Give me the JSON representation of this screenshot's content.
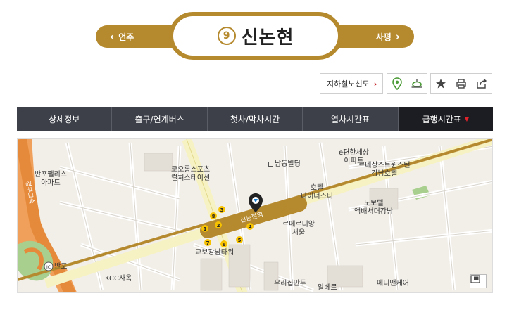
{
  "station": {
    "line_number": "9",
    "name": "신논현",
    "prev_label": "언주",
    "next_label": "사평"
  },
  "tools": {
    "subway_map_link": "지하철노선도",
    "icons": [
      "location-pin-icon",
      "bus-stop-icon",
      "star-icon",
      "print-icon",
      "share-icon"
    ]
  },
  "tabs": [
    {
      "label": "상세정보"
    },
    {
      "label": "출구/연계버스"
    },
    {
      "label": "첫차/막차시간"
    },
    {
      "label": "열차시간표"
    },
    {
      "label": "급행시간표"
    }
  ],
  "map": {
    "labels": {
      "namdong": "남동빌딩",
      "e_pyeonhan": "e편한세상\n아파트",
      "gangnam_west": "르네상스트윈스턴\n강남호텔",
      "banpo_palace": "반포팰리스\n아파트",
      "kolon": "코오롱스포츠\n컬쳐스테이션",
      "hotel_dynasty": "호텔\n다이너스티",
      "nobotel": "노보텔\n앰배서더강남",
      "station": "신논현역",
      "rehmer": "르메르디앙\n서울",
      "kyobo": "교보강남타워",
      "kcc": "KCC사옥",
      "woori": "우리집만두",
      "almere": "알베르",
      "meditcare": "메디앤케어",
      "banpo_ic": "반포",
      "expressway": "경부고속"
    },
    "exits": [
      "1",
      "2",
      "3",
      "4",
      "5",
      "6",
      "7",
      "8"
    ]
  },
  "colors": {
    "line9": "#b5892d",
    "tab_bg": "#3d4049",
    "tab_active": "#1c1d22",
    "accent_red": "#e0222a"
  }
}
